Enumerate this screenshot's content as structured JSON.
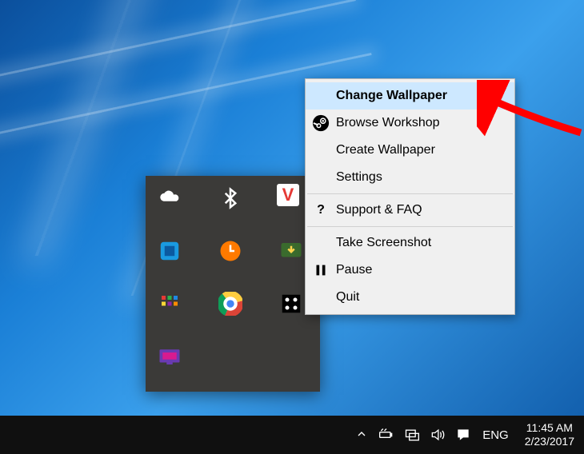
{
  "context_menu": {
    "items": [
      {
        "label": "Change Wallpaper",
        "bold": true,
        "highlight": true,
        "icon": null
      },
      {
        "label": "Browse Workshop",
        "icon": "steam-icon"
      },
      {
        "label": "Create Wallpaper",
        "icon": null
      },
      {
        "label": "Settings",
        "icon": null
      },
      {
        "separator": true
      },
      {
        "label": "Support & FAQ",
        "icon": "question-icon"
      },
      {
        "separator": true
      },
      {
        "label": "Take Screenshot",
        "icon": null
      },
      {
        "label": "Pause",
        "icon": "pause-icon"
      },
      {
        "label": "Quit",
        "icon": null
      }
    ]
  },
  "tray_icons": [
    "onedrive-icon",
    "bluetooth-icon",
    "antivirus-icon",
    "intel-graphics-icon",
    "updater-icon",
    "idm-icon",
    "pixel-app-icon",
    "chrome-icon",
    "wallpaper-engine-icon",
    "display-app-icon"
  ],
  "taskbar": {
    "lang": "ENG",
    "time": "11:45 AM",
    "date": "2/23/2017"
  },
  "annotation": {
    "kind": "arrow",
    "color": "#ff0000"
  }
}
